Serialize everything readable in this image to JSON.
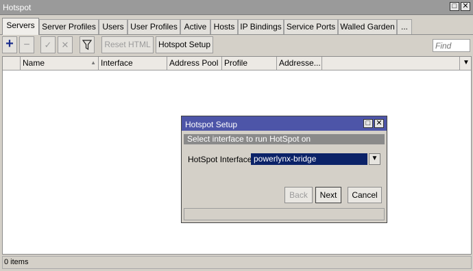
{
  "window": {
    "title": "Hotspot"
  },
  "tabs": [
    {
      "label": "Servers",
      "active": true
    },
    {
      "label": "Server Profiles"
    },
    {
      "label": "Users"
    },
    {
      "label": "User Profiles"
    },
    {
      "label": "Active"
    },
    {
      "label": "Hosts"
    },
    {
      "label": "IP Bindings"
    },
    {
      "label": "Service Ports"
    },
    {
      "label": "Walled Garden"
    },
    {
      "label": "..."
    }
  ],
  "toolbar": {
    "add_icon": "+",
    "remove_icon": "−",
    "enable_icon": "✓",
    "disable_icon": "✕",
    "filter_icon": "funnel",
    "reset_html_label": "Reset HTML",
    "hotspot_setup_label": "Hotspot Setup",
    "find_placeholder": "Find"
  },
  "table": {
    "columns": [
      "Name",
      "Interface",
      "Address Pool",
      "Profile",
      "Addresse..."
    ],
    "rows": []
  },
  "status": {
    "items_text": "0 items"
  },
  "dialog": {
    "title": "Hotspot Setup",
    "subtitle": "Select interface to run HotSpot on",
    "interface_label": "HotSpot Interface:",
    "interface_value": "powerlynx-bridge",
    "back_label": "Back",
    "next_label": "Next",
    "cancel_label": "Cancel"
  },
  "colors": {
    "dialog_title_bg": "#4d55a8",
    "selected_field_bg": "#0b2268",
    "add_icon": "#1a2d8c"
  }
}
